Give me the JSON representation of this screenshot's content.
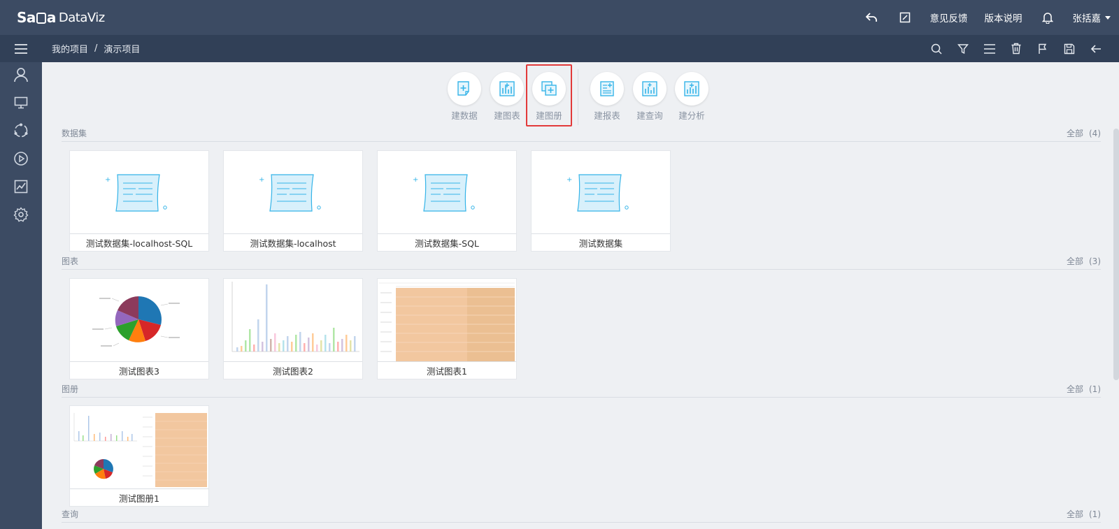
{
  "app": {
    "logo_prefix": "Sa",
    "logo_suffix": "a",
    "logo_product": "DataViz"
  },
  "header": {
    "feedback": "意见反馈",
    "release_notes": "版本说明",
    "user": "张括嘉"
  },
  "breadcrumb": {
    "root": "我的项目",
    "separator": "/",
    "current": "演示项目"
  },
  "toolbar": {
    "items": [
      {
        "label": "建数据"
      },
      {
        "label": "建图表"
      },
      {
        "label": "建图册"
      },
      {
        "label": "建报表"
      },
      {
        "label": "建查询"
      },
      {
        "label": "建分析"
      }
    ],
    "icon_color": "#35b4e8"
  },
  "sections": {
    "datasets": {
      "title": "数据集",
      "all": "全部",
      "count": "(4)",
      "cards": [
        "测试数据集-localhost-SQL",
        "测试数据集-localhost",
        "测试数据集-SQL",
        "测试数据集"
      ]
    },
    "charts": {
      "title": "图表",
      "all": "全部",
      "count": "(3)",
      "cards": [
        "测试图表3",
        "测试图表2",
        "测试图表1"
      ]
    },
    "albums": {
      "title": "图册",
      "all": "全部",
      "count": "(1)",
      "cards": [
        "测试图册1"
      ]
    },
    "queries": {
      "title": "查询",
      "all": "全部",
      "count": "(1)"
    }
  },
  "colors": {
    "topbar": "#3c4b63",
    "subbar": "#314057",
    "highlight": "#e23a3a",
    "table_fill": "#f2c79f"
  }
}
